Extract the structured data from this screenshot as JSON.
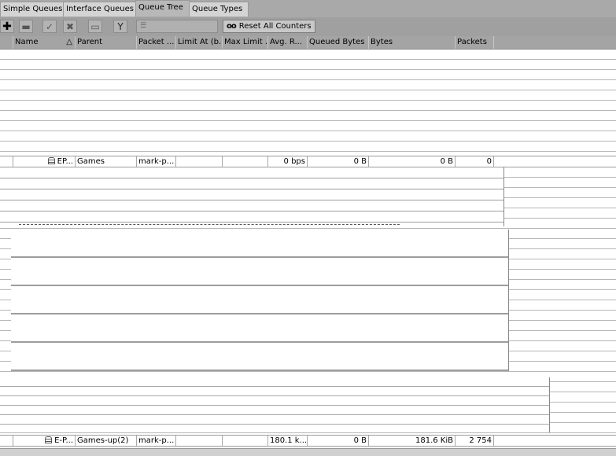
{
  "tabs": [
    {
      "label": "Simple Queues",
      "active": false
    },
    {
      "label": "Interface Queues",
      "active": false
    },
    {
      "label": "Queue Tree",
      "active": true
    },
    {
      "label": "Queue Types",
      "active": false
    }
  ],
  "toolbar": {
    "add_icon": "plus-icon",
    "remove_icon": "minus-icon",
    "enable_icon": "check-icon",
    "disable_icon": "cross-icon",
    "comment_icon": "comment-icon",
    "filter_icon": "filter-icon",
    "search_placeholder": "",
    "reset_all_counters": "Reset All Counters",
    "reset_icon": "oo"
  },
  "columns": [
    "Name",
    "Parent",
    "Packet ...",
    "Limit At (b...",
    "Max Limit ...",
    "Avg. R...",
    "Queued Bytes",
    "Bytes",
    "Packets"
  ],
  "sort_indicator": "△",
  "rows": [
    {
      "name": "EP...",
      "parent": "Games",
      "packet": "mark-p...",
      "limit_at": "",
      "max_limit": "",
      "avg_rate": "0 bps",
      "queued_bytes": "0 B",
      "bytes": "0 B",
      "packets": "0"
    },
    {
      "name": "E-P...",
      "parent": "Games-up(2)",
      "packet": "mark-p...",
      "limit_at": "",
      "max_limit": "",
      "avg_rate": "180.1 k...",
      "queued_bytes": "0 B",
      "bytes": "181.6 KiB",
      "packets": "2 754"
    }
  ]
}
